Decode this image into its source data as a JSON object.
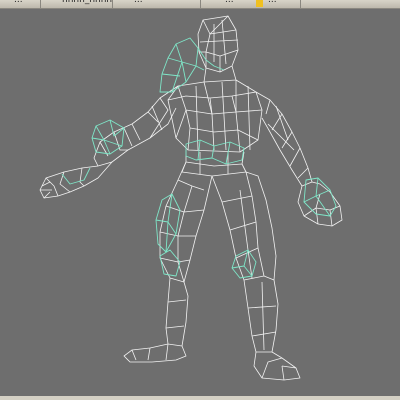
{
  "toolbar": {
    "item_a": "...",
    "item_b": "hhhh_hhhh",
    "item_c": "...",
    "item_d": "...",
    "item_e": "..."
  },
  "viewport": {
    "background_color": "#6e6e6e",
    "wire_white": "#f2f2f2",
    "wire_selected": "#7fe6c8",
    "content": "wireframe-character-model"
  },
  "colors": {
    "toolbar_bg": "#cfcbbf",
    "active_swatch": "#f0c020"
  }
}
